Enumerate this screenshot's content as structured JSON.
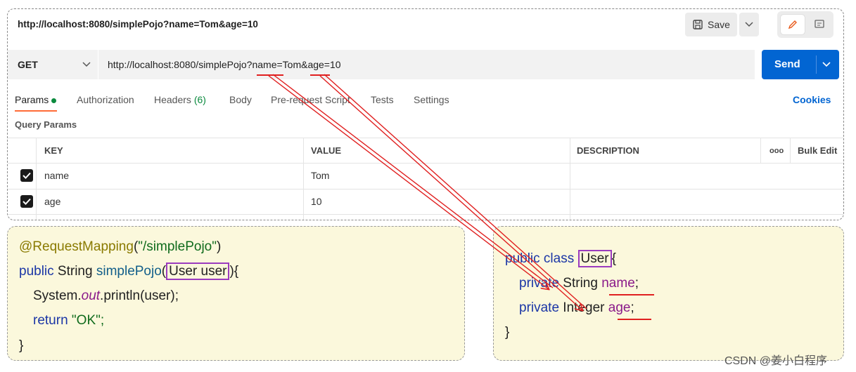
{
  "titlebar": {
    "url": "http://localhost:8080/simplePojo?name=Tom&age=10",
    "save_label": "Save"
  },
  "request": {
    "method": "GET",
    "url": "http://localhost:8080/simplePojo?name=Tom&age=10",
    "send_label": "Send"
  },
  "tabs": [
    {
      "label": "Params",
      "active": true
    },
    {
      "label": "Authorization"
    },
    {
      "label": "Headers",
      "count": "(6)"
    },
    {
      "label": "Body"
    },
    {
      "label": "Pre-request Script"
    },
    {
      "label": "Tests"
    },
    {
      "label": "Settings"
    }
  ],
  "cookies_label": "Cookies",
  "query_params_label": "Query Params",
  "table": {
    "headers": [
      "KEY",
      "VALUE",
      "DESCRIPTION",
      "ooo",
      "Bulk Edit"
    ],
    "rows": [
      {
        "key": "name",
        "value": "Tom",
        "checked": true
      },
      {
        "key": "age",
        "value": "10",
        "checked": true
      }
    ]
  },
  "controller_code": {
    "annotation": "@RequestMapping",
    "annotation_paren_open": "(",
    "annotation_string": "\"/simplePojo\"",
    "annotation_paren_close": ")",
    "kw_public": "public",
    "type_string": " String ",
    "method_name": "simplePojo",
    "paren_open": "(",
    "param": "User user",
    "paren_close_brace": "){",
    "sys": "System.",
    "out": "out",
    "println": ".println(user);",
    "kw_return": "return",
    "return_value": " \"OK\";",
    "close": "}"
  },
  "user_code": {
    "kw_public_class": "public class",
    "class_name": "User",
    "open_brace": "{",
    "kw_private": "private",
    "type1": " String ",
    "field1": "name",
    "semi": ";",
    "type2": " Integer ",
    "field2": "age",
    "close": "}"
  },
  "watermark": "CSDN @姜小白程序",
  "colors": {
    "send_blue": "#0265d2",
    "annotation_red": "#e02020",
    "highlight_purple": "#9b3bbf",
    "code_bg": "#fbf8dc"
  }
}
